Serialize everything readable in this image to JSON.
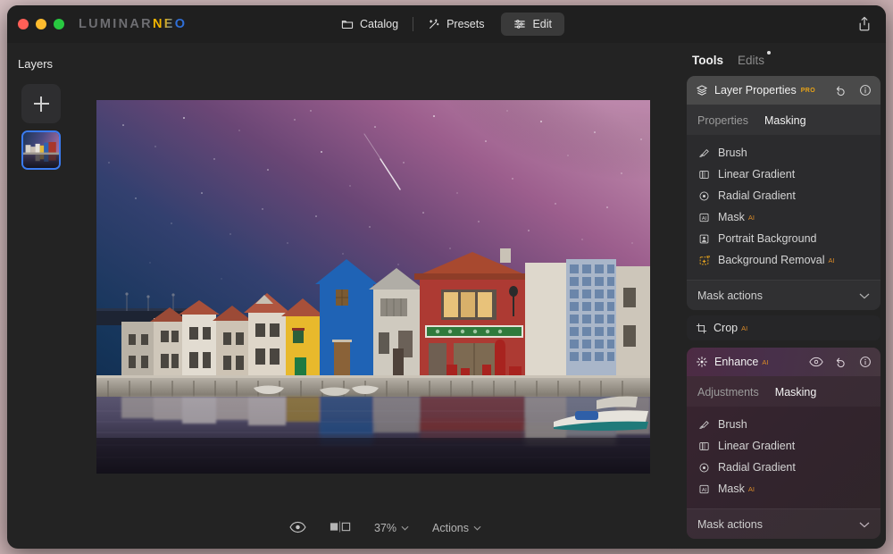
{
  "window": {
    "brand_primary": "LUMINAR",
    "brand_accent": "NEO",
    "traffic_lights": [
      "close",
      "minimize",
      "zoom"
    ]
  },
  "header": {
    "tabs": [
      {
        "label": "Catalog",
        "icon": "folder-icon",
        "active": false
      },
      {
        "label": "Presets",
        "icon": "wand-icon",
        "active": false
      },
      {
        "label": "Edit",
        "icon": "sliders-icon",
        "active": true
      }
    ],
    "share_icon": "share-upload-icon"
  },
  "layers": {
    "title": "Layers",
    "add_button_icon": "plus-icon",
    "thumbnail_name": "layer-thumbnail-1",
    "selection_color": "#3a7bf0"
  },
  "canvas": {
    "image_alt": "Night photo of colorful riverside houses under the Milky Way with reflection"
  },
  "bottom_bar": {
    "preview_icon": "eye-icon",
    "compare_icon": "before-after-icon",
    "zoom_level": "37%",
    "actions_label": "Actions",
    "chevron": "⌄"
  },
  "tools_panel": {
    "tabs": [
      {
        "label": "Tools",
        "active": true,
        "dot": false
      },
      {
        "label": "Edits",
        "active": false,
        "dot": true
      }
    ],
    "cards": [
      {
        "id": "layer-properties",
        "title": "Layer Properties",
        "icon": "layers-stack-icon",
        "badge": "PRO",
        "badge_type": "pro",
        "head_actions": [
          "reset-icon",
          "info-icon"
        ],
        "subtabs": [
          {
            "label": "Properties",
            "active": false
          },
          {
            "label": "Masking",
            "active": true
          }
        ],
        "mask_items": [
          {
            "label": "Brush",
            "icon": "brush-icon",
            "badge": ""
          },
          {
            "label": "Linear Gradient",
            "icon": "linear-gradient-icon",
            "badge": ""
          },
          {
            "label": "Radial Gradient",
            "icon": "radial-gradient-icon",
            "badge": ""
          },
          {
            "label": "Mask",
            "icon": "ai-mask-icon",
            "badge": "AI"
          },
          {
            "label": "Portrait Background",
            "icon": "portrait-icon",
            "badge": ""
          },
          {
            "label": "Background Removal",
            "icon": "background-removal-icon",
            "badge": "AI"
          }
        ],
        "mask_actions_label": "Mask actions"
      },
      {
        "id": "enhance",
        "title": "Enhance",
        "icon": "enhance-sparkle-icon",
        "badge": "AI",
        "badge_type": "ai",
        "head_actions": [
          "eye-icon",
          "reset-icon",
          "info-icon"
        ],
        "subtabs": [
          {
            "label": "Adjustments",
            "active": false
          },
          {
            "label": "Masking",
            "active": true
          }
        ],
        "mask_items": [
          {
            "label": "Brush",
            "icon": "brush-icon",
            "badge": ""
          },
          {
            "label": "Linear Gradient",
            "icon": "linear-gradient-icon",
            "badge": ""
          },
          {
            "label": "Radial Gradient",
            "icon": "radial-gradient-icon",
            "badge": ""
          },
          {
            "label": "Mask",
            "icon": "ai-mask-icon",
            "badge": "AI"
          }
        ],
        "mask_actions_label": "Mask actions"
      }
    ],
    "tool_rows": [
      {
        "label": "Crop",
        "icon": "crop-icon",
        "badge": "AI"
      }
    ]
  },
  "colors": {
    "window_bg": "#232323",
    "titlebar_bg": "#1f1f1f",
    "card_bg": "#2b2b2d",
    "card_head_bg": "#4a4a4a",
    "enhance_accent": "#4d2b44",
    "ai_badge": "#d98a28",
    "pro_badge": "#e8a317"
  }
}
